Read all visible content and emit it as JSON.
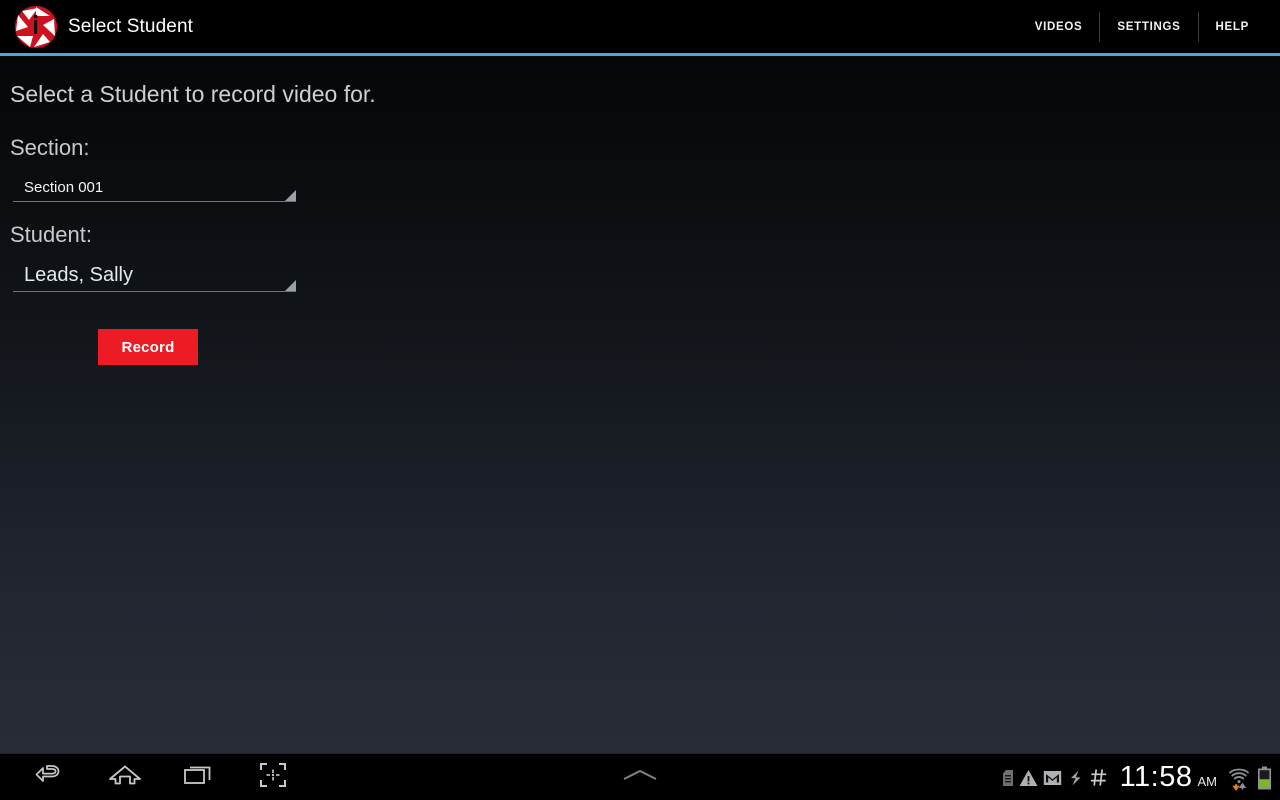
{
  "app": {
    "logo_icon": "camera-aperture-logo",
    "title": "Select Student"
  },
  "action_bar": {
    "menu": [
      {
        "label": "VIDEOS",
        "name": "videos"
      },
      {
        "label": "SETTINGS",
        "name": "settings"
      },
      {
        "label": "HELP",
        "name": "help"
      }
    ],
    "accent_rule_color": "#4aa8d8"
  },
  "main": {
    "headline": "Select a Student to record video for.",
    "fields": [
      {
        "label": "Section:",
        "value": "Section 001",
        "icon": "dropdown-triangle-icon"
      },
      {
        "label": "Student:",
        "value": "Leads,  Sally",
        "icon": "dropdown-triangle-icon"
      }
    ],
    "record_button": {
      "label": "Record",
      "color": "#ed1c24"
    }
  },
  "navbar": {
    "buttons": [
      {
        "name": "back",
        "icon": "back-arrow-icon"
      },
      {
        "name": "home",
        "icon": "home-icon"
      },
      {
        "name": "recents",
        "icon": "recent-apps-icon"
      },
      {
        "name": "screenshot",
        "icon": "screenshot-icon"
      }
    ],
    "handle_icon": "chevron-up-icon",
    "status_icons": [
      {
        "name": "sd-card-icon"
      },
      {
        "name": "warning-triangle-icon"
      },
      {
        "name": "gmail-icon"
      },
      {
        "name": "usb-sync-icon"
      },
      {
        "name": "hash-icon"
      }
    ],
    "clock": {
      "time": "11:58",
      "ampm": "AM"
    },
    "wifi_icon": "wifi-signal-icon",
    "battery_icon": "battery-icon"
  }
}
